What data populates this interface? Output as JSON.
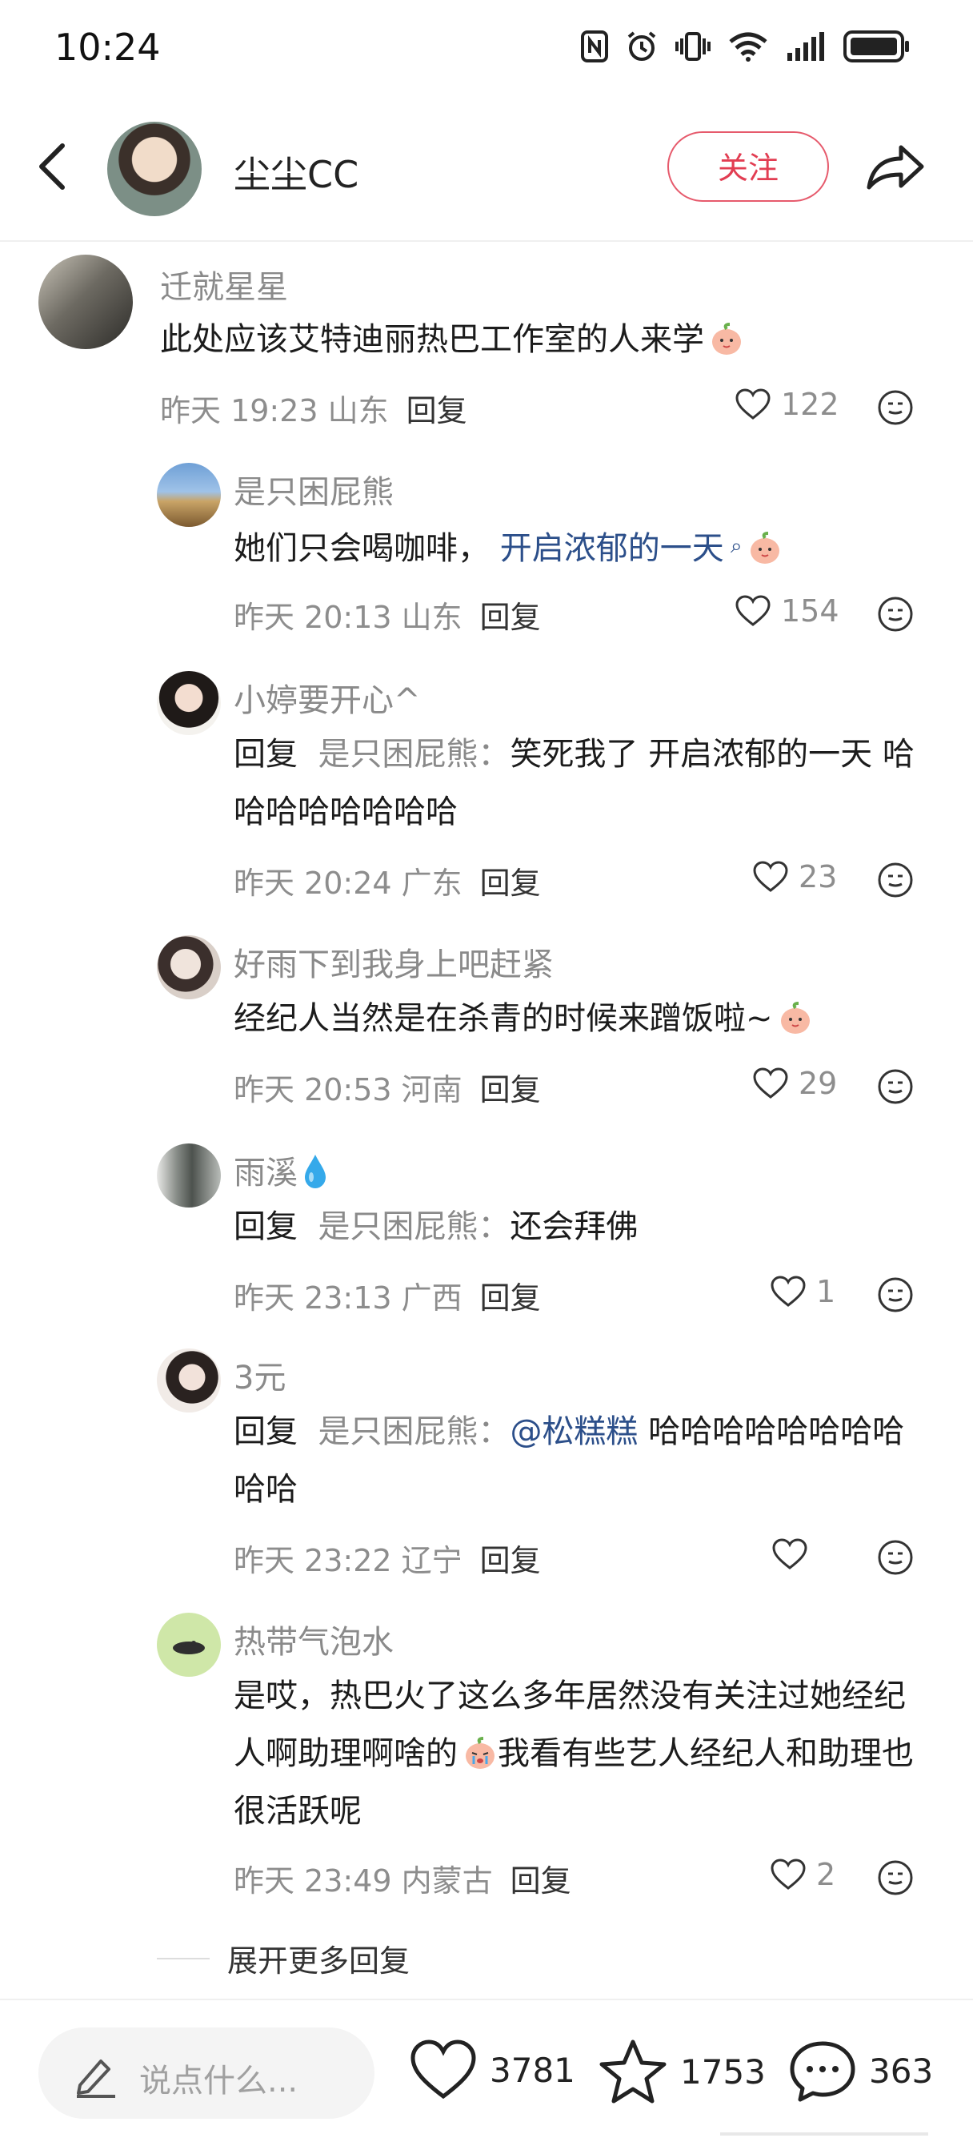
{
  "status_bar": {
    "time": "10:24"
  },
  "header": {
    "name": "尘尘CC",
    "follow_label": "关注"
  },
  "comments": [
    {
      "user": "迁就星星",
      "text": "此处应该艾特迪丽热巴工作室的人来学",
      "time": "昨天 19:23 山东",
      "reply_label": "回复",
      "likes": "122"
    },
    {
      "user": "是只困屁熊",
      "text": "她们只会喝咖啡，",
      "link": "开启浓郁的一天",
      "time": "昨天 20:13 山东",
      "reply_label": "回复",
      "likes": "154"
    },
    {
      "user": "小婷要开心^",
      "prefix": "回复",
      "target": "是只困屁熊：",
      "text": "笑死我了 开启浓郁的一天 哈哈哈哈哈哈哈哈",
      "time": "昨天 20:24 广东",
      "reply_label": "回复",
      "likes": "23"
    },
    {
      "user": "好雨下到我身上吧赶紧",
      "text": "经纪人当然是在杀青的时候来蹭饭啦~",
      "time": "昨天 20:53 河南",
      "reply_label": "回复",
      "likes": "29"
    },
    {
      "user": "雨溪",
      "prefix": "回复",
      "target": "是只困屁熊：",
      "text": "还会拜佛",
      "time": "昨天 23:13 广西",
      "reply_label": "回复",
      "likes": "1"
    },
    {
      "user": "3元",
      "prefix": "回复",
      "target": "是只困屁熊：",
      "mention": "@松糕糕",
      "text": " 哈哈哈哈哈哈哈哈哈哈",
      "time": "昨天 23:22 辽宁",
      "reply_label": "回复",
      "likes": ""
    },
    {
      "user": "热带气泡水",
      "text": "是哎，热巴火了这么多年居然没有关注过她经纪人啊助理啊啥的",
      "text2": "我看有些艺人经纪人和助理也很活跃呢",
      "time": "昨天 23:49 内蒙古",
      "reply_label": "回复",
      "likes": "2"
    }
  ],
  "more_replies": "展开更多回复",
  "bottom_bar": {
    "placeholder": "说点什么...",
    "likes": "3781",
    "favorites": "1753",
    "comments": "363"
  },
  "icons": [
    "back-arrow-icon",
    "share-icon",
    "heart-icon",
    "emoji-icon",
    "peach-emoji-icon",
    "droplet-emoji-icon",
    "crying-emoji-icon",
    "pencil-icon",
    "star-icon",
    "comment-bubble-icon"
  ],
  "colors": {
    "accent": "#e23d52",
    "link": "#2c4f8a",
    "muted": "#8a8a8a"
  }
}
